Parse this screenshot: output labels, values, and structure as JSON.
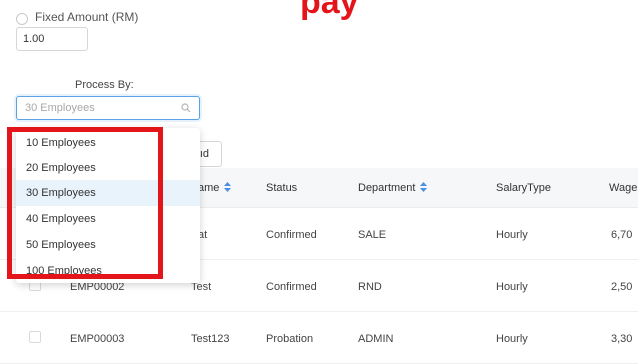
{
  "header": {
    "title_fragment": "pay"
  },
  "payment_option": {
    "radio_label": "Fixed Amount (RM)",
    "amount_value": "1.00"
  },
  "process_by": {
    "label": "Process By:",
    "selected": "30 Employees",
    "options": [
      "10 Employees",
      "20 Employees",
      "30 Employees",
      "40 Employees",
      "50 Employees",
      "100 Employees"
    ],
    "selected_index": 2
  },
  "toolbar": {
    "button_fragment": "ıd"
  },
  "table": {
    "columns": {
      "name": "ame",
      "status": "Status",
      "department": "Department",
      "salary_type": "SalaryType",
      "wage": "Wage"
    },
    "rows": [
      {
        "id": "",
        "name": "at",
        "status": "Confirmed",
        "department": "SALE",
        "salary_type": "Hourly",
        "wage": "6,70"
      },
      {
        "id": "EMP00002",
        "name": "Test",
        "status": "Confirmed",
        "department": "RND",
        "salary_type": "Hourly",
        "wage": "2,50"
      },
      {
        "id": "EMP00003",
        "name": "Test123",
        "status": "Probation",
        "department": "ADMIN",
        "salary_type": "Hourly",
        "wage": "3,30"
      }
    ]
  },
  "colors": {
    "accent_red": "#e4141b",
    "sort_blue": "#4a90e2",
    "focus_blue": "#5aa3e6",
    "selected_bg": "#e8f3fc"
  }
}
